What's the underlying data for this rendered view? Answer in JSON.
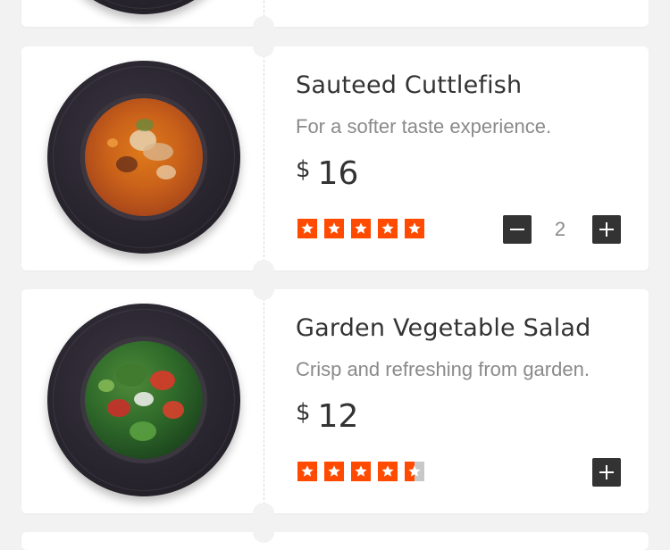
{
  "accent_color": "#ff4a00",
  "button_color": "#333333",
  "items": [
    {
      "name": "Sauteed Cuttlefish",
      "description": "For a softer taste experience.",
      "currency": "$",
      "price": "16",
      "rating": 5,
      "quantity": "2",
      "image_icon": "soup-plate-image"
    },
    {
      "name": "Garden Vegetable Salad",
      "description": "Crisp and refreshing from garden.",
      "currency": "$",
      "price": "12",
      "rating": 4.5,
      "quantity": "",
      "image_icon": "salad-plate-image"
    }
  ]
}
